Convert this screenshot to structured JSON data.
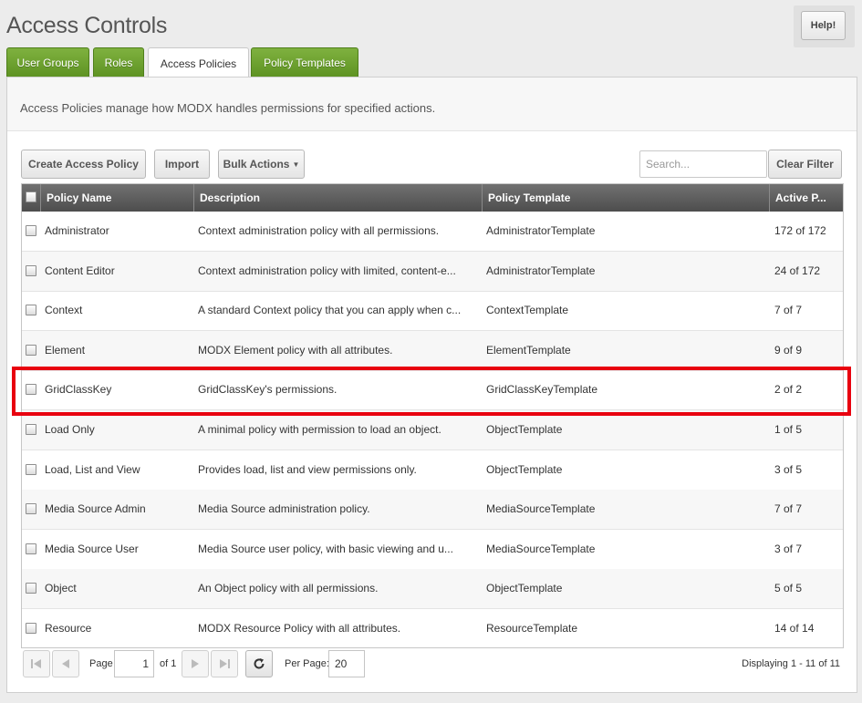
{
  "header": {
    "title": "Access Controls",
    "help_label": "Help!"
  },
  "tabs": [
    {
      "label": "User Groups"
    },
    {
      "label": "Roles"
    },
    {
      "label": "Access Policies"
    },
    {
      "label": "Policy Templates"
    }
  ],
  "panel": {
    "description": "Access Policies manage how MODX handles permissions for specified actions."
  },
  "toolbar": {
    "create_label": "Create Access Policy",
    "import_label": "Import",
    "bulk_label": "Bulk Actions",
    "search_placeholder": "Search...",
    "clear_label": "Clear Filter"
  },
  "grid": {
    "columns": [
      "Policy Name",
      "Description",
      "Policy Template",
      "Active P..."
    ],
    "rows": [
      {
        "name": "Administrator",
        "description": "Context administration policy with all permissions.",
        "template": "AdministratorTemplate",
        "active": "172 of 172"
      },
      {
        "name": "Content Editor",
        "description": "Context administration policy with limited, content-e...",
        "template": "AdministratorTemplate",
        "active": "24 of 172"
      },
      {
        "name": "Context",
        "description": "A standard Context policy that you can apply when c...",
        "template": "ContextTemplate",
        "active": "7 of 7"
      },
      {
        "name": "Element",
        "description": "MODX Element policy with all attributes.",
        "template": "ElementTemplate",
        "active": "9 of 9"
      },
      {
        "name": "GridClassKey",
        "description": "GridClassKey's permissions.",
        "template": "GridClassKeyTemplate",
        "active": "2 of 2"
      },
      {
        "name": "Load Only",
        "description": "A minimal policy with permission to load an object.",
        "template": "ObjectTemplate",
        "active": "1 of 5"
      },
      {
        "name": "Load, List and View",
        "description": "Provides load, list and view permissions only.",
        "template": "ObjectTemplate",
        "active": "3 of 5"
      },
      {
        "name": "Media Source Admin",
        "description": "Media Source administration policy.",
        "template": "MediaSourceTemplate",
        "active": "7 of 7"
      },
      {
        "name": "Media Source User",
        "description": "Media Source user policy, with basic viewing and u...",
        "template": "MediaSourceTemplate",
        "active": "3 of 7"
      },
      {
        "name": "Object",
        "description": "An Object policy with all permissions.",
        "template": "ObjectTemplate",
        "active": "5 of 5"
      },
      {
        "name": "Resource",
        "description": "MODX Resource Policy with all attributes.",
        "template": "ResourceTemplate",
        "active": "14 of 14"
      }
    ]
  },
  "pager": {
    "page_label": "Page",
    "page_value": "1",
    "of_label": "of 1",
    "per_page_label": "Per Page:",
    "per_page_value": "20",
    "display_label": "Displaying 1 - 11 of 11"
  },
  "icons": {
    "first": "first-page-icon",
    "prev": "prev-page-icon",
    "next": "next-page-icon",
    "last": "last-page-icon",
    "refresh": "refresh-icon"
  },
  "colors": {
    "tab_green": "#6ba22e",
    "highlight": "#e8000f",
    "header_bg": "#5e5e5e"
  }
}
